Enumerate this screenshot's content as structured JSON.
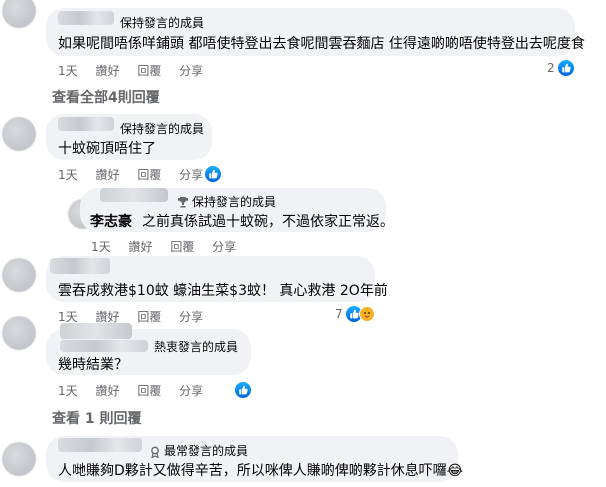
{
  "comments": [
    {
      "badge": "保持發言的成員",
      "text": "如果呢間唔係咩鋪頭 都唔使特登出去食呢間雲吞麵店 住得遠啲啲唔使特登出去呢度食",
      "time": "1天",
      "like_label": "讚好",
      "reply_label": "回覆",
      "share_label": "分享",
      "reaction_count": "2"
    },
    {
      "badge": "保持發言的成員",
      "text": "十蚊碗頂唔住了",
      "time": "1天",
      "like_label": "讚好",
      "reply_label": "回覆",
      "share_label": "分享",
      "reaction_count": ""
    },
    {
      "badge": "保持發言的成員",
      "author": "李志豪",
      "text": "之前真係試過十蚊碗，不過依家正常返。",
      "time": "1天",
      "like_label": "讚好",
      "reply_label": "回覆",
      "share_label": "分享"
    },
    {
      "badge": "",
      "text": "雲吞成救港$10蚊 蠔油生菜$3蚊！ 真心救港 2O年前",
      "time": "1天",
      "like_label": "讚好",
      "reply_label": "回覆",
      "share_label": "分享",
      "reaction_count": "7"
    },
    {
      "badge": "熱衷發言的成員",
      "text": "幾時結業？",
      "time": "1天",
      "like_label": "讚好",
      "reply_label": "回覆",
      "share_label": "分享"
    },
    {
      "badge": "最常發言的成員",
      "text": "人哋賺夠D夥計又做得辛苦，所以咪俾人賺啲俾啲夥計休息吓囉😂",
      "time": "",
      "like_label": "",
      "reply_label": "",
      "share_label": ""
    }
  ],
  "view_replies_1": "查看全部4則回覆",
  "view_replies_2": "查看 1 則回覆",
  "colors": {
    "bubble": "#f0f2f5",
    "like_blue": "#0866ff",
    "muted": "#65676b"
  }
}
